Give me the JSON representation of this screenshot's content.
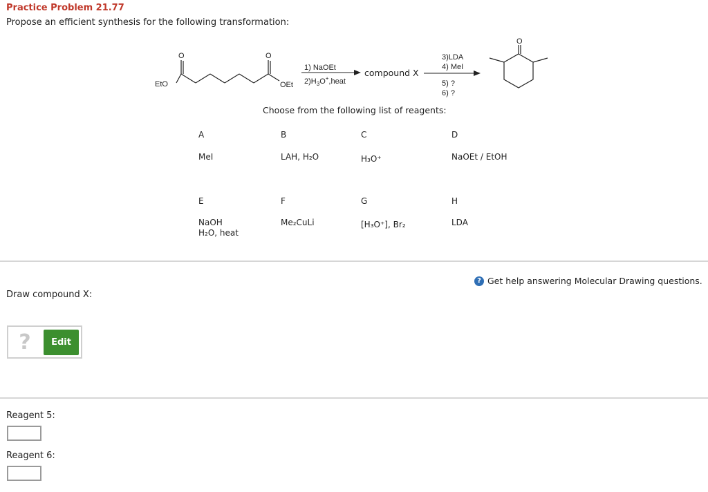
{
  "header": {
    "title": "Practice Problem 21.77",
    "prompt": "Propose an efficient synthesis for the following transformation:"
  },
  "scheme": {
    "substituent_left": "EtO",
    "substituent_right": "OEt",
    "oxygen": "O",
    "step1_reagent1": "1) NaOEt",
    "step1_reagent2_pre": "2)H",
    "step1_reagent2_sub": "3",
    "step1_reagent2_mid": "O",
    "step1_reagent2_sup": "+",
    "step1_reagent2_post": ",heat",
    "intermediate": "compound X",
    "step2_reagent3": "3)LDA",
    "step2_reagent4": "4) MeI",
    "step2_reagent5": "5) ?",
    "step2_reagent6": "6) ?"
  },
  "choose_text": "Choose from the following list of reagents:",
  "reagents": [
    {
      "letter": "A",
      "line1": "MeI"
    },
    {
      "letter": "B",
      "line1": "LAH, H₂O"
    },
    {
      "letter": "C",
      "line1": "H₃O⁺"
    },
    {
      "letter": "D",
      "line1": "NaOEt / EtOH"
    },
    {
      "letter": "E",
      "line1": "NaOH",
      "line2": "H₂O, heat"
    },
    {
      "letter": "F",
      "line1": "Me₂CuLi"
    },
    {
      "letter": "G",
      "line1": "[H₃O⁺], Br₂"
    },
    {
      "letter": "H",
      "line1": "LDA"
    }
  ],
  "help": {
    "icon": "question-circle-icon",
    "text": "Get help answering Molecular Drawing questions."
  },
  "draw": {
    "label": "Draw compound X:",
    "placeholder_icon": "question-mark-icon",
    "placeholder_glyph": "?",
    "edit_label": "Edit"
  },
  "answers": [
    {
      "label": "Reagent 5:",
      "value": ""
    },
    {
      "label": "Reagent 6:",
      "value": ""
    }
  ],
  "colors": {
    "title": "#c0392b",
    "edit_button": "#3c8f2f",
    "help_icon": "#2f6fb5",
    "divider": "#d6d6d6"
  }
}
